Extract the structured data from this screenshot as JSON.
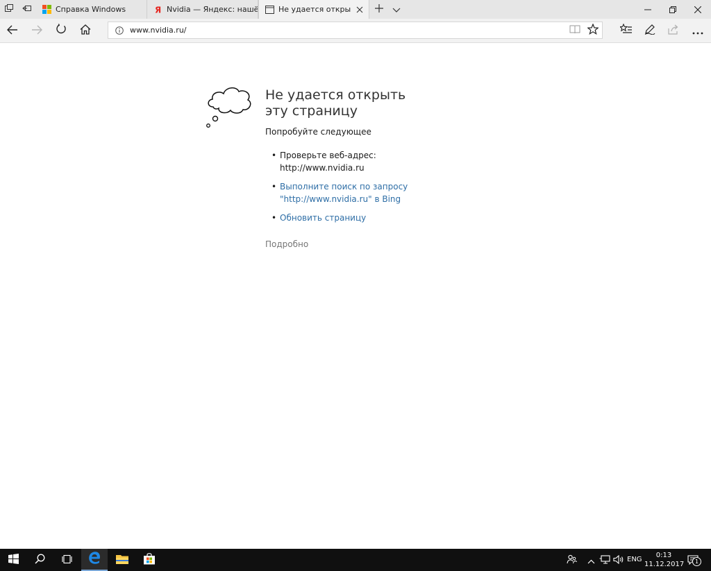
{
  "tabs": [
    {
      "title": "Справка Windows",
      "active": false,
      "icon": "windows-logo-icon"
    },
    {
      "title": "Nvidia — Яндекс: нашёлся",
      "active": false,
      "icon": "yandex-icon"
    },
    {
      "title": "Не удается открыть эту",
      "active": true,
      "icon": "page-icon"
    }
  ],
  "address_bar": {
    "url": "www.nvidia.ru/"
  },
  "error_page": {
    "title": "Не удается открыть эту страницу",
    "subtitle": "Попробуйте следующее",
    "suggestions": [
      {
        "text": "Проверьте веб-адрес: http://www.nvidia.ru",
        "link": false
      },
      {
        "text": "Выполните поиск по запросу \"http://www.nvidia.ru\" в Bing",
        "link": true
      },
      {
        "text": "Обновить страницу",
        "link": true
      }
    ],
    "details_label": "Подробно"
  },
  "taskbar": {
    "language": "ENG",
    "time": "0:13",
    "date": "11.12.2017",
    "notification_count": "1"
  },
  "colors": {
    "link": "#2e6ea6",
    "taskbar": "#101010",
    "tabbar": "#e6e6e6",
    "toolbar": "#f2f2f2",
    "edge_blue": "#1e88e5"
  }
}
